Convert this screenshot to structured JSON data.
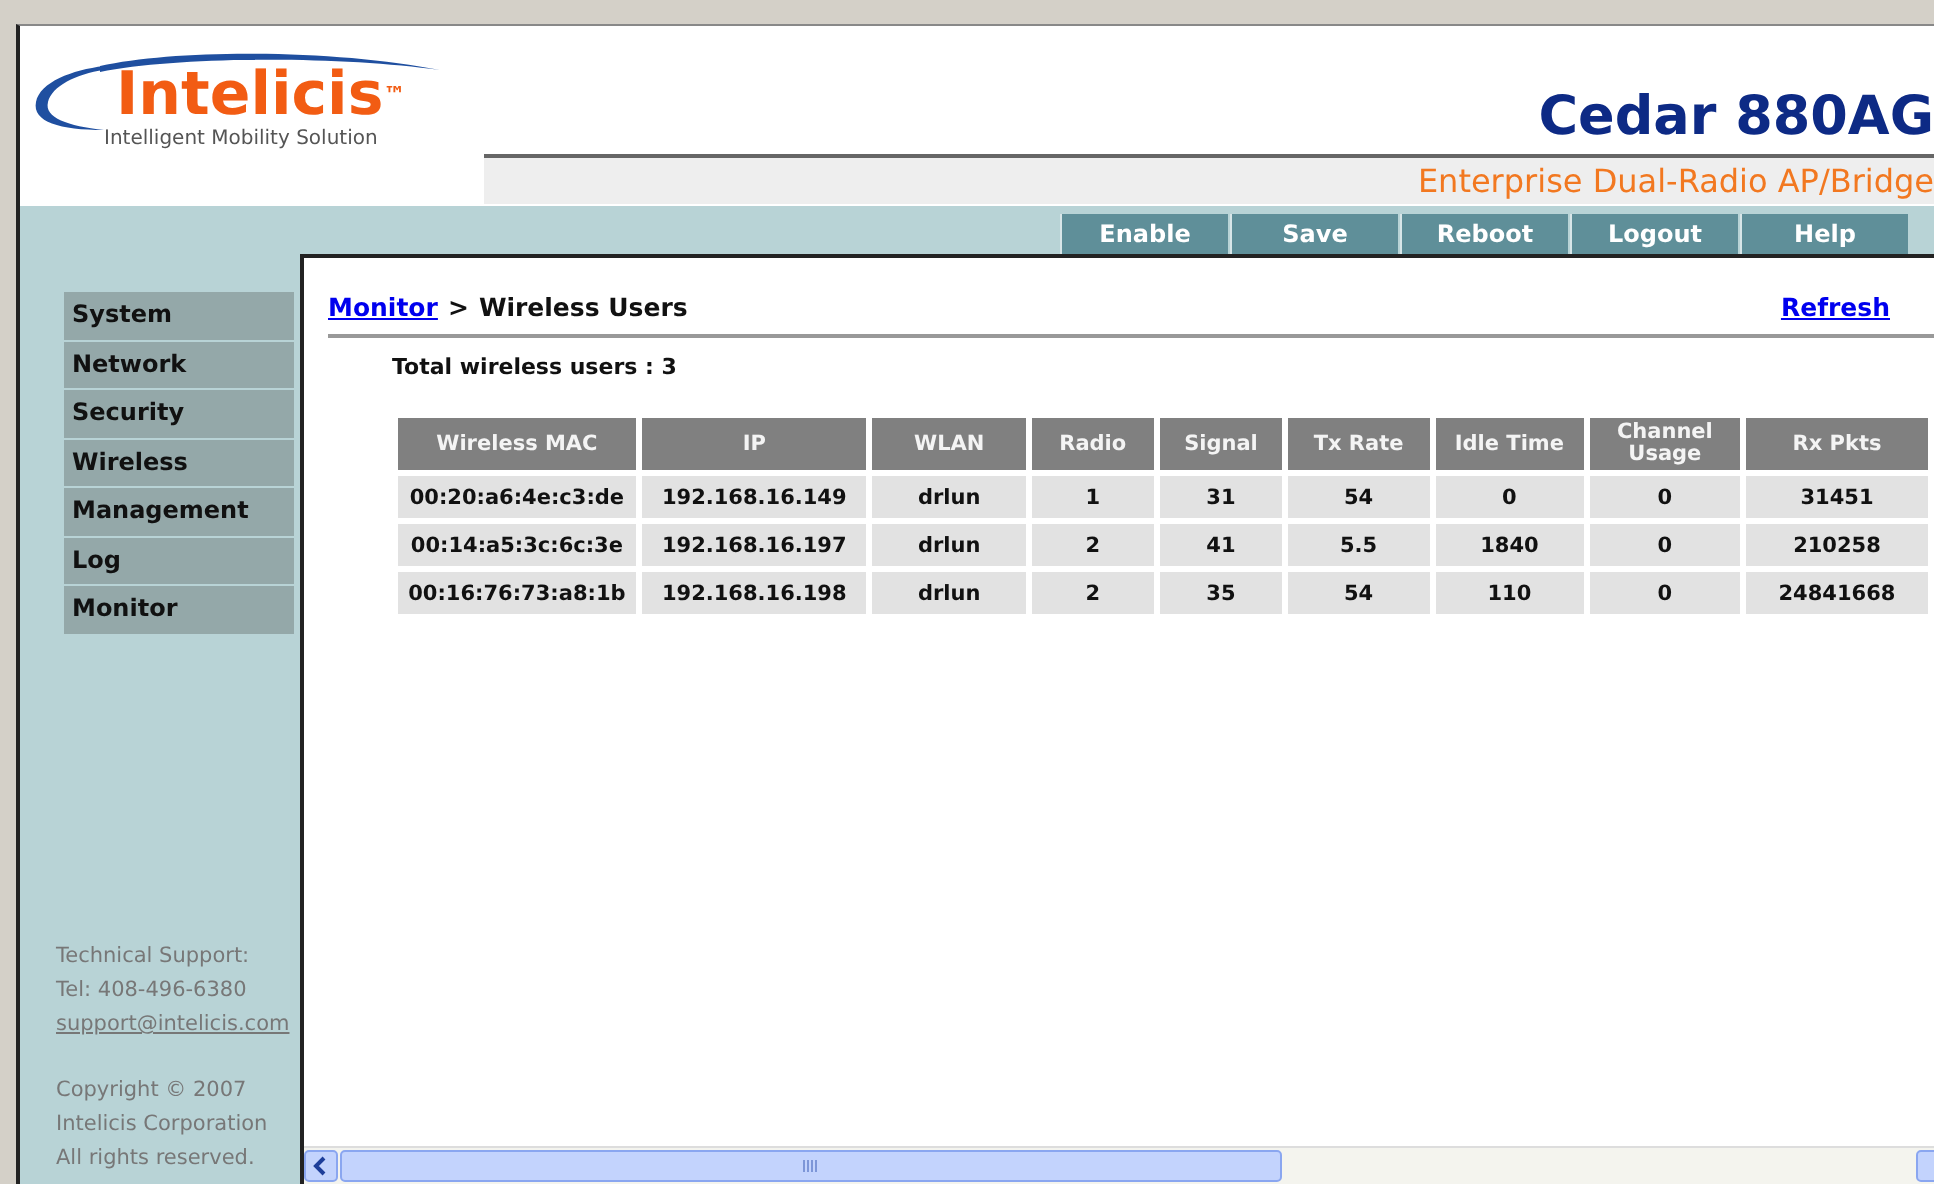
{
  "logo": {
    "name": "Intelicis",
    "mark": "™",
    "tagline": "Intelligent Mobility Solution"
  },
  "product": {
    "title": "Cedar 880AG",
    "subtitle": "Enterprise Dual-Radio AP/Bridge"
  },
  "toolbar": [
    "Enable",
    "Save",
    "Reboot",
    "Logout",
    "Help"
  ],
  "sidebar": {
    "items": [
      {
        "label": "System",
        "selected": false
      },
      {
        "label": "Network",
        "selected": false
      },
      {
        "label": "Security",
        "selected": false
      },
      {
        "label": "Wireless",
        "selected": false
      },
      {
        "label": "Management",
        "selected": false
      },
      {
        "label": "Log",
        "selected": false
      },
      {
        "label": "Monitor",
        "selected": false
      }
    ],
    "support": {
      "heading": "Technical Support:",
      "phone": "Tel: 408-496-6380",
      "email": "support@intelicis.com"
    },
    "copyright": [
      "Copyright © 2007",
      "Intelicis Corporation",
      "All rights reserved."
    ]
  },
  "breadcrumb": {
    "link": "Monitor",
    "separator": ">",
    "current": "Wireless Users"
  },
  "refresh": "Refresh",
  "total": "Total wireless users : 3",
  "table": {
    "columns": [
      "Wireless MAC",
      "IP",
      "WLAN",
      "Radio",
      "Signal",
      "Tx Rate",
      "Idle Time",
      "Channel Usage",
      "Rx Pkts"
    ],
    "rows": [
      [
        "00:20:a6:4e:c3:de",
        "192.168.16.149",
        "drlun",
        "1",
        "31",
        "54",
        "0",
        "0",
        "31451"
      ],
      [
        "00:14:a5:3c:6c:3e",
        "192.168.16.197",
        "drlun",
        "2",
        "41",
        "5.5",
        "1840",
        "0",
        "210258"
      ],
      [
        "00:16:76:73:a8:1b",
        "192.168.16.198",
        "drlun",
        "2",
        "35",
        "54",
        "110",
        "0",
        "24841668"
      ]
    ]
  }
}
